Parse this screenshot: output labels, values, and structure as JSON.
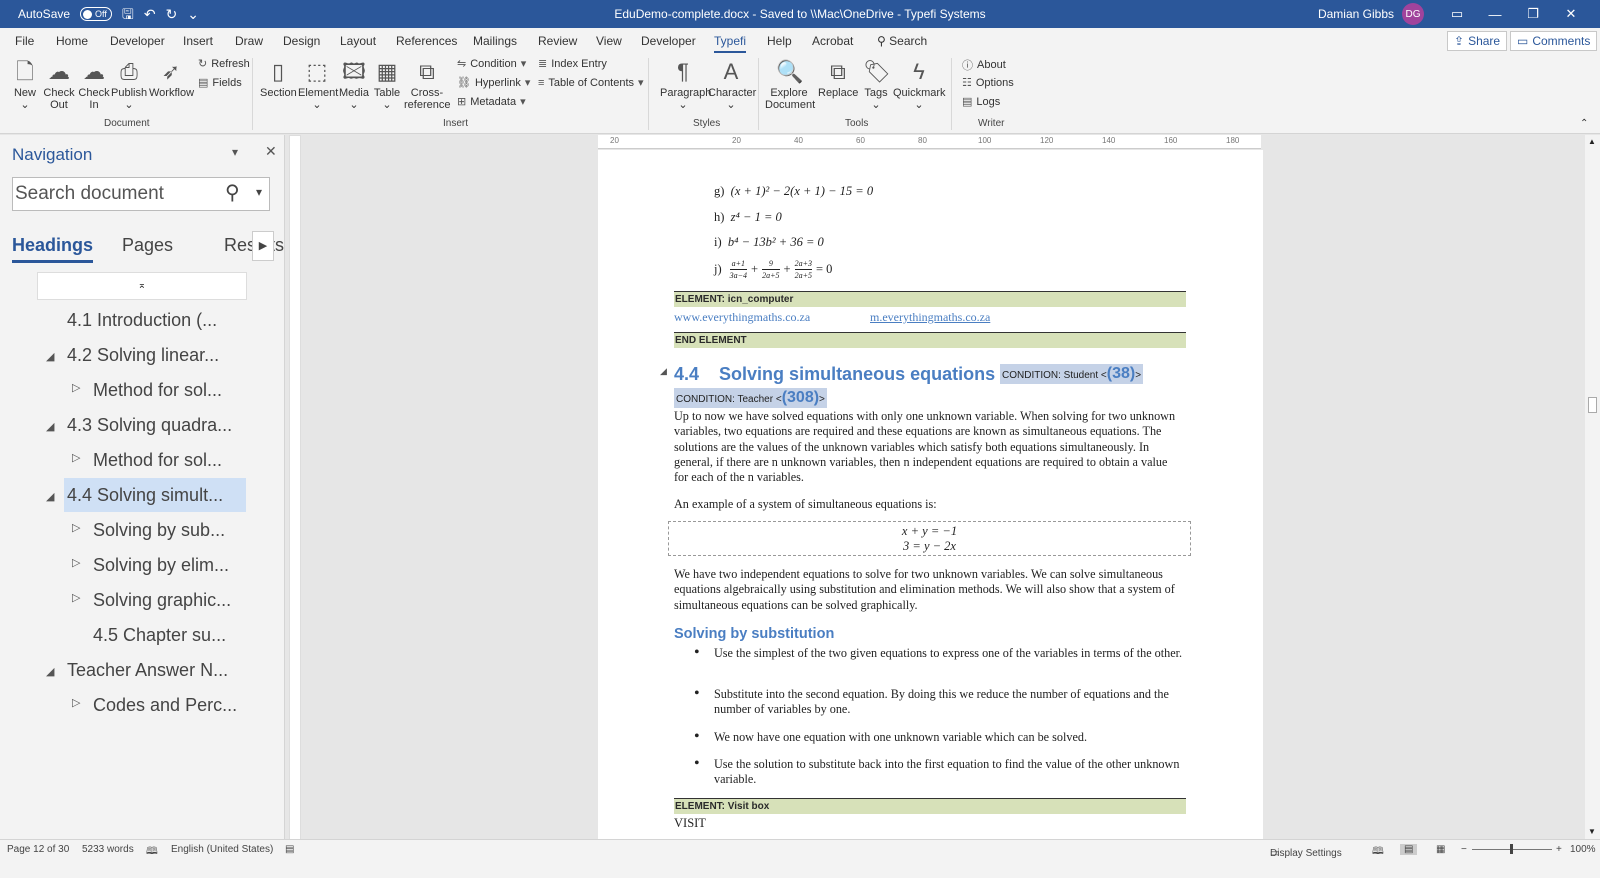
{
  "titlebar": {
    "autosave_label": "AutoSave",
    "autosave_state": "Off",
    "doc_title": "EduDemo-complete.docx  -  Saved to \\\\Mac\\OneDrive  -  Typefi Systems",
    "user_name": "Damian Gibbs",
    "user_initials": "DG"
  },
  "tabs": [
    "File",
    "Home",
    "Developer",
    "Insert",
    "Draw",
    "Design",
    "Layout",
    "References",
    "Mailings",
    "Review",
    "View",
    "Developer",
    "Typefi",
    "Help",
    "Acrobat"
  ],
  "active_tab": "Typefi",
  "search_tab": "Search",
  "share_label": "Share",
  "comments_label": "Comments",
  "ribbon": {
    "document": {
      "new": "New",
      "check_out": [
        "Check",
        "Out"
      ],
      "check_in": [
        "Check",
        "In"
      ],
      "publish": "Publish",
      "workflow": "Workflow",
      "refresh": "Refresh",
      "fields": "Fields",
      "group": "Document"
    },
    "insert": {
      "section": "Section",
      "element": "Element",
      "media": "Media",
      "table": "Table",
      "crossref": [
        "Cross-",
        "reference"
      ],
      "condition": "Condition",
      "hyperlink": "Hyperlink",
      "metadata": "Metadata",
      "index_entry": "Index Entry",
      "toc": "Table of Contents",
      "group": "Insert"
    },
    "styles": {
      "paragraph": "Paragraph",
      "character": "Character",
      "group": "Styles"
    },
    "tools": {
      "explore": [
        "Explore",
        "Document"
      ],
      "replace": "Replace",
      "tags": "Tags",
      "quickmark": "Quickmark",
      "group": "Tools"
    },
    "writer": {
      "about": "About",
      "options": "Options",
      "logs": "Logs",
      "group": "Writer"
    }
  },
  "nav": {
    "title": "Navigation",
    "search_placeholder": "Search document",
    "tabs": [
      "Headings",
      "Pages",
      "Results"
    ],
    "items": [
      "4.1 Introduction  (...",
      "4.2 Solving linear...",
      "Method for sol...",
      "4.3 Solving quadra...",
      "Method for sol...",
      "4.4 Solving simult...",
      "Solving by sub...",
      "Solving by elim...",
      "Solving graphic...",
      "4.5 Chapter su...",
      "Teacher Answer N...",
      "Codes and Perc..."
    ]
  },
  "ruler": [
    "20",
    "20",
    "40",
    "60",
    "80",
    "100",
    "120",
    "140",
    "160",
    "180"
  ],
  "doc": {
    "eqs": [
      {
        "label": "g)",
        "text": "(x + 1)² − 2(x + 1) − 15 = 0"
      },
      {
        "label": "h)",
        "text": "z⁴ − 1 = 0"
      },
      {
        "label": "i)",
        "text": "b⁴ − 13b² + 36 = 0"
      },
      {
        "label": "j)",
        "num1": "a+1",
        "den1": "3a−4",
        "num2": "9",
        "den2": "2a+5",
        "num3": "2a+3",
        "den3": "2a+5",
        "tail": "= 0"
      }
    ],
    "el1": "ELEMENT: icn_computer",
    "link1": "www.everythingmaths.co.za",
    "link2": "m.everythingmaths.co.za",
    "endel": "END ELEMENT",
    "heading_num": "4.4",
    "heading": "Solving simultaneous equations",
    "cond_student": "CONDITION: Student <",
    "cond_student_num": "(38)",
    "cond_teacher": "CONDITION: Teacher <",
    "cond_teacher_num": "(308)",
    "p1": "Up to now we have solved equations with only one unknown variable. When solving for two unknown variables, two equations are required and these equations are known as simultaneous equations. The solutions are the values of the unknown variables which satisfy both equations simultaneously. In general, if there are n unknown variables, then n independent equations are required to obtain a value for each of the n variables.",
    "p2": "An example of a system of simultaneous equations is:",
    "sys1": "x + y = −1",
    "sys2": "3 = y − 2x",
    "p3": "We have two independent equations to solve for two unknown variables. We can solve simultaneous equations algebraically using substitution and elimination methods. We will also show that a system of simultaneous equations can be solved graphically.",
    "subheading": "Solving by substitution",
    "bullets": [
      "Use the simplest of the two given equations to express one of the variables in terms of the other.",
      "Substitute into the second equation. By doing this we reduce the number of equations and the number of variables by one.",
      "We now have one equation with one unknown variable which can be solved.",
      "Use the solution to substitute back into the first equation to find the value of the other unknown variable."
    ],
    "el2": "ELEMENT: Visit box",
    "visit": "VISIT"
  },
  "status": {
    "page": "Page 12 of 30",
    "words": "5233 words",
    "language": "English (United States)",
    "display": "Display Settings",
    "zoom": "100%"
  }
}
